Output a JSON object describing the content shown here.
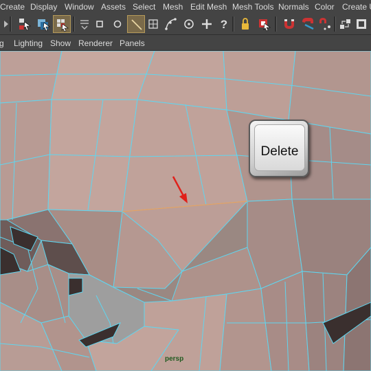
{
  "menubar": {
    "items": [
      "Create",
      "Display",
      "Window",
      "Assets",
      "Select",
      "Mesh",
      "Edit Mesh",
      "Mesh Tools",
      "Normals",
      "Color",
      "Create U"
    ]
  },
  "toolbar": {
    "tools": [
      {
        "icon": "expand-arrow-icon"
      },
      {
        "icon": "select-by-hierarchy-icon"
      },
      {
        "icon": "select-by-object-icon"
      },
      {
        "icon": "select-by-component-icon",
        "active": true
      },
      {
        "icon": "vertex-mode-icon"
      },
      {
        "icon": "face-mode-icon"
      },
      {
        "icon": "object-mode-icon"
      },
      {
        "icon": "edge-mode-icon",
        "active": true
      },
      {
        "icon": "uv-mode-icon"
      },
      {
        "icon": "curve-icon"
      },
      {
        "icon": "snap-point-icon"
      },
      {
        "icon": "snap-grid-icon"
      },
      {
        "icon": "help-icon"
      },
      {
        "icon": "lock-icon"
      },
      {
        "icon": "select-highlight-icon"
      },
      {
        "icon": "magnet-icon"
      },
      {
        "icon": "symmetry-magnet-icon"
      },
      {
        "icon": "soft-select-icon"
      },
      {
        "icon": "layout-icon"
      },
      {
        "icon": "render-icon"
      }
    ]
  },
  "panel_menu": {
    "items": [
      "g",
      "Lighting",
      "Show",
      "Renderer",
      "Panels"
    ]
  },
  "viewport": {
    "camera": "persp",
    "mesh_color": "#c3a59e",
    "wire_color": "#5fd6f0",
    "selected_edge_color": "#e8a060"
  },
  "overlay": {
    "key_label": "Delete",
    "arrow_color": "#e0201a"
  }
}
